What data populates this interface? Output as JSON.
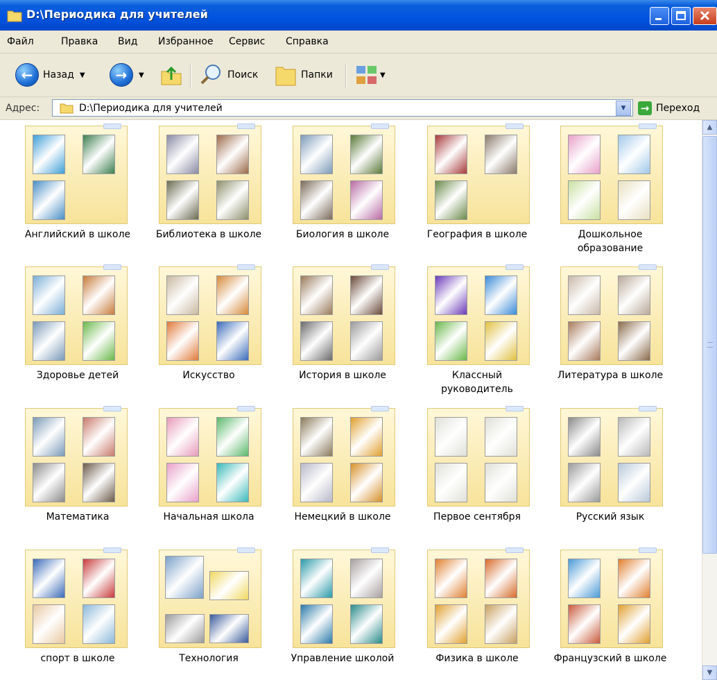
{
  "window": {
    "title": "D:\\Периодика для учителей"
  },
  "menu": [
    "Файл",
    "Правка",
    "Вид",
    "Избранное",
    "Сервис",
    "Справка"
  ],
  "toolbar": {
    "back_label": "Назад",
    "search_label": "Поиск",
    "folders_label": "Папки"
  },
  "address": {
    "label": "Адрес:",
    "value": "D:\\Периодика для учителей",
    "go_label": "Переход"
  },
  "folders": [
    {
      "name": "Английский в школе",
      "covers": [
        "#3f9ed6",
        "#3d7f4f",
        "#4a8ec4"
      ]
    },
    {
      "name": "Библиотека в школе",
      "covers": [
        "#8a8aa4",
        "#9d6a4a",
        "#6b6b52",
        "#8c8f6a"
      ]
    },
    {
      "name": "Биология в школе",
      "covers": [
        "#7c9bb8",
        "#5a7a3a",
        "#7a6a5a",
        "#b86aa4"
      ]
    },
    {
      "name": "География в школе",
      "covers": [
        "#a83a3a",
        "#8a7a6a",
        "#6a8a4a"
      ]
    },
    {
      "name": "Дошкольное образование",
      "covers": [
        "#e8a0c8",
        "#a0c8e8",
        "#c8e0a0",
        "#e8e0c0"
      ]
    },
    {
      "name": "Здоровье детей",
      "covers": [
        "#7aaed6",
        "#c87a3a",
        "#7a9ab8",
        "#6ab84a"
      ]
    },
    {
      "name": "Искусство",
      "covers": [
        "#c8b8a0",
        "#d68a3a",
        "#e07a3a",
        "#3a6ab8"
      ]
    },
    {
      "name": "История в школе",
      "covers": [
        "#9a7a5a",
        "#6a4a3a",
        "#6a6a6a",
        "#9a9a9a"
      ]
    },
    {
      "name": "Классный руководитель",
      "covers": [
        "#6a3ab8",
        "#3a8ad6",
        "#6ab84a",
        "#e0c040"
      ]
    },
    {
      "name": "Литература в школе",
      "covers": [
        "#c8b8a8",
        "#b8a898",
        "#a87a5a",
        "#8a6a4a"
      ]
    },
    {
      "name": "Математика",
      "covers": [
        "#7a9ab8",
        "#c87a6a",
        "#8a8a8a",
        "#6a5a4a"
      ]
    },
    {
      "name": "Начальная школа",
      "covers": [
        "#e89ab8",
        "#5ab86a",
        "#e8a0c8",
        "#3ab8b8"
      ]
    },
    {
      "name": "Немецкий в школе",
      "covers": [
        "#8a7a5a",
        "#e0a030",
        "#b8b8c8",
        "#d6902a"
      ]
    },
    {
      "name": "Первое сентября",
      "covers": [
        "#e0e0d8",
        "#e0e0d8",
        "#e0e0d8",
        "#e0e0d8"
      ]
    },
    {
      "name": "Русский язык",
      "covers": [
        "#8a8a8a",
        "#b8b8b8",
        "#9a9a9a",
        "#b8c8d8"
      ]
    },
    {
      "name": "спорт в школе",
      "covers": [
        "#3a6ab8",
        "#c83a3a",
        "#e8c8a0",
        "#8ab8d8"
      ]
    },
    {
      "name": "Технология",
      "covers": [
        "#7aa0c8",
        "#f0d860",
        "#9a9a9a",
        "#3a5a9a"
      ]
    },
    {
      "name": "Управление школой",
      "covers": [
        "#2a9aa8",
        "#a8a0a0",
        "#2a7aa8",
        "#2a8a8a"
      ]
    },
    {
      "name": "Физика в школе",
      "covers": [
        "#e08030",
        "#d66a2a",
        "#e0a030",
        "#c8a060"
      ]
    },
    {
      "name": "Французский в школе",
      "covers": [
        "#4a9ad6",
        "#e08030",
        "#c85a3a",
        "#e0a030"
      ]
    }
  ]
}
